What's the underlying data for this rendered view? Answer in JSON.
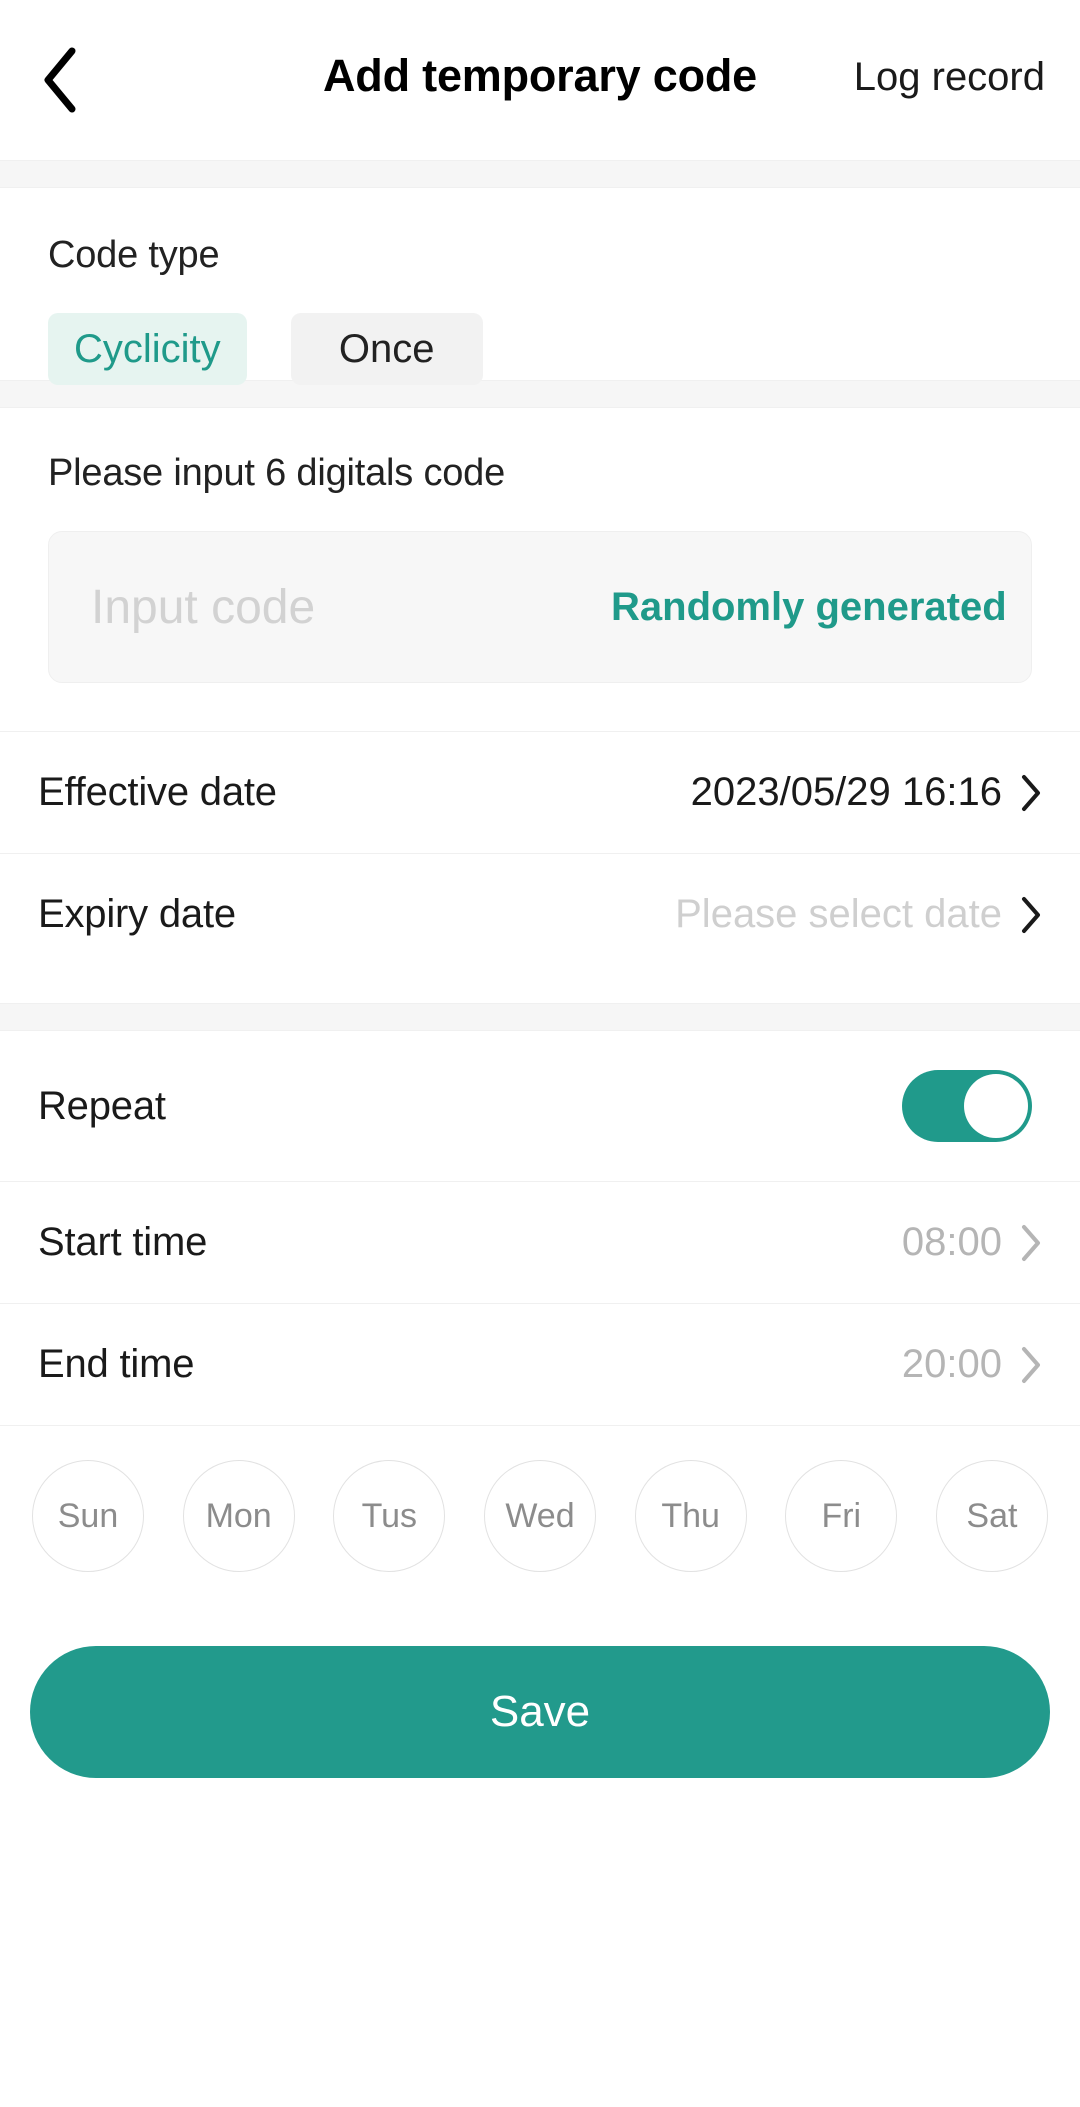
{
  "header": {
    "back_icon": "chevron-left-icon",
    "title": "Add temporary code",
    "action_label": "Log record"
  },
  "code_type": {
    "label": "Code type",
    "options": [
      {
        "label": "Cyclicity",
        "selected": true
      },
      {
        "label": "Once",
        "selected": false
      }
    ]
  },
  "code_input": {
    "label": "Please input 6 digitals code",
    "value": "",
    "placeholder": "Input code",
    "random_label": "Randomly generated"
  },
  "date_rows": [
    {
      "label": "Effective date",
      "value": "2023/05/29 16:16",
      "is_placeholder": false
    },
    {
      "label": "Expiry date",
      "value": "Please select date",
      "is_placeholder": true
    }
  ],
  "repeat": {
    "label": "Repeat",
    "enabled": true
  },
  "time_rows": [
    {
      "label": "Start time",
      "value": "08:00"
    },
    {
      "label": "End time",
      "value": "20:00"
    }
  ],
  "days": [
    {
      "label": "Sun",
      "selected": false
    },
    {
      "label": "Mon",
      "selected": false
    },
    {
      "label": "Tus",
      "selected": false
    },
    {
      "label": "Wed",
      "selected": false
    },
    {
      "label": "Thu",
      "selected": false
    },
    {
      "label": "Fri",
      "selected": false
    },
    {
      "label": "Sat",
      "selected": false
    }
  ],
  "save": {
    "label": "Save"
  },
  "colors": {
    "accent": "#229a8c",
    "accent_light": "#e6f4f0",
    "chip_bg": "#f2f2f2",
    "band": "#f6f6f6",
    "muted_text": "#b5b5b5",
    "placeholder_text": "#d2d2d2"
  }
}
